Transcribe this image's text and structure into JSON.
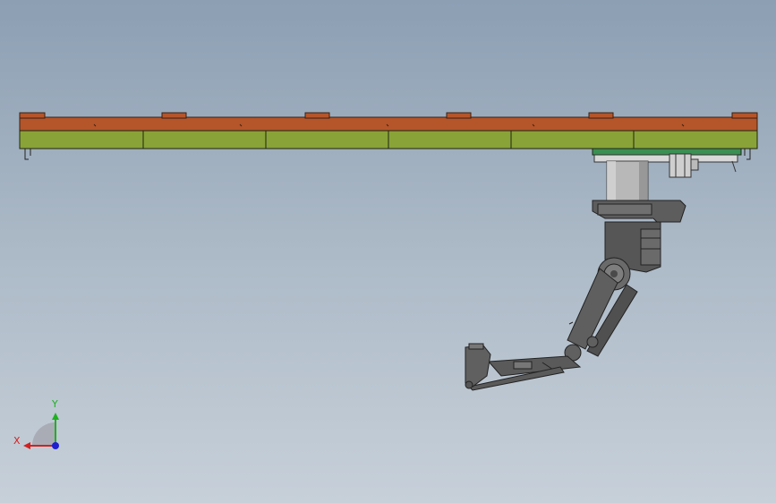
{
  "viewport": {
    "background_top": "#8c9fb3",
    "background_bottom": "#c7d0d9"
  },
  "model": {
    "rail_colors": {
      "top_beam": "#b5552a",
      "lower_beam": "#8aa338",
      "carriage_plate": "#3a8f52",
      "robot_body": "#5d5d5d",
      "column": "#b8b8b8"
    }
  },
  "triad": {
    "x_label": "X",
    "y_label": "Y",
    "x_color": "#d42020",
    "y_color": "#20b020",
    "z_color": "#2020d0"
  }
}
